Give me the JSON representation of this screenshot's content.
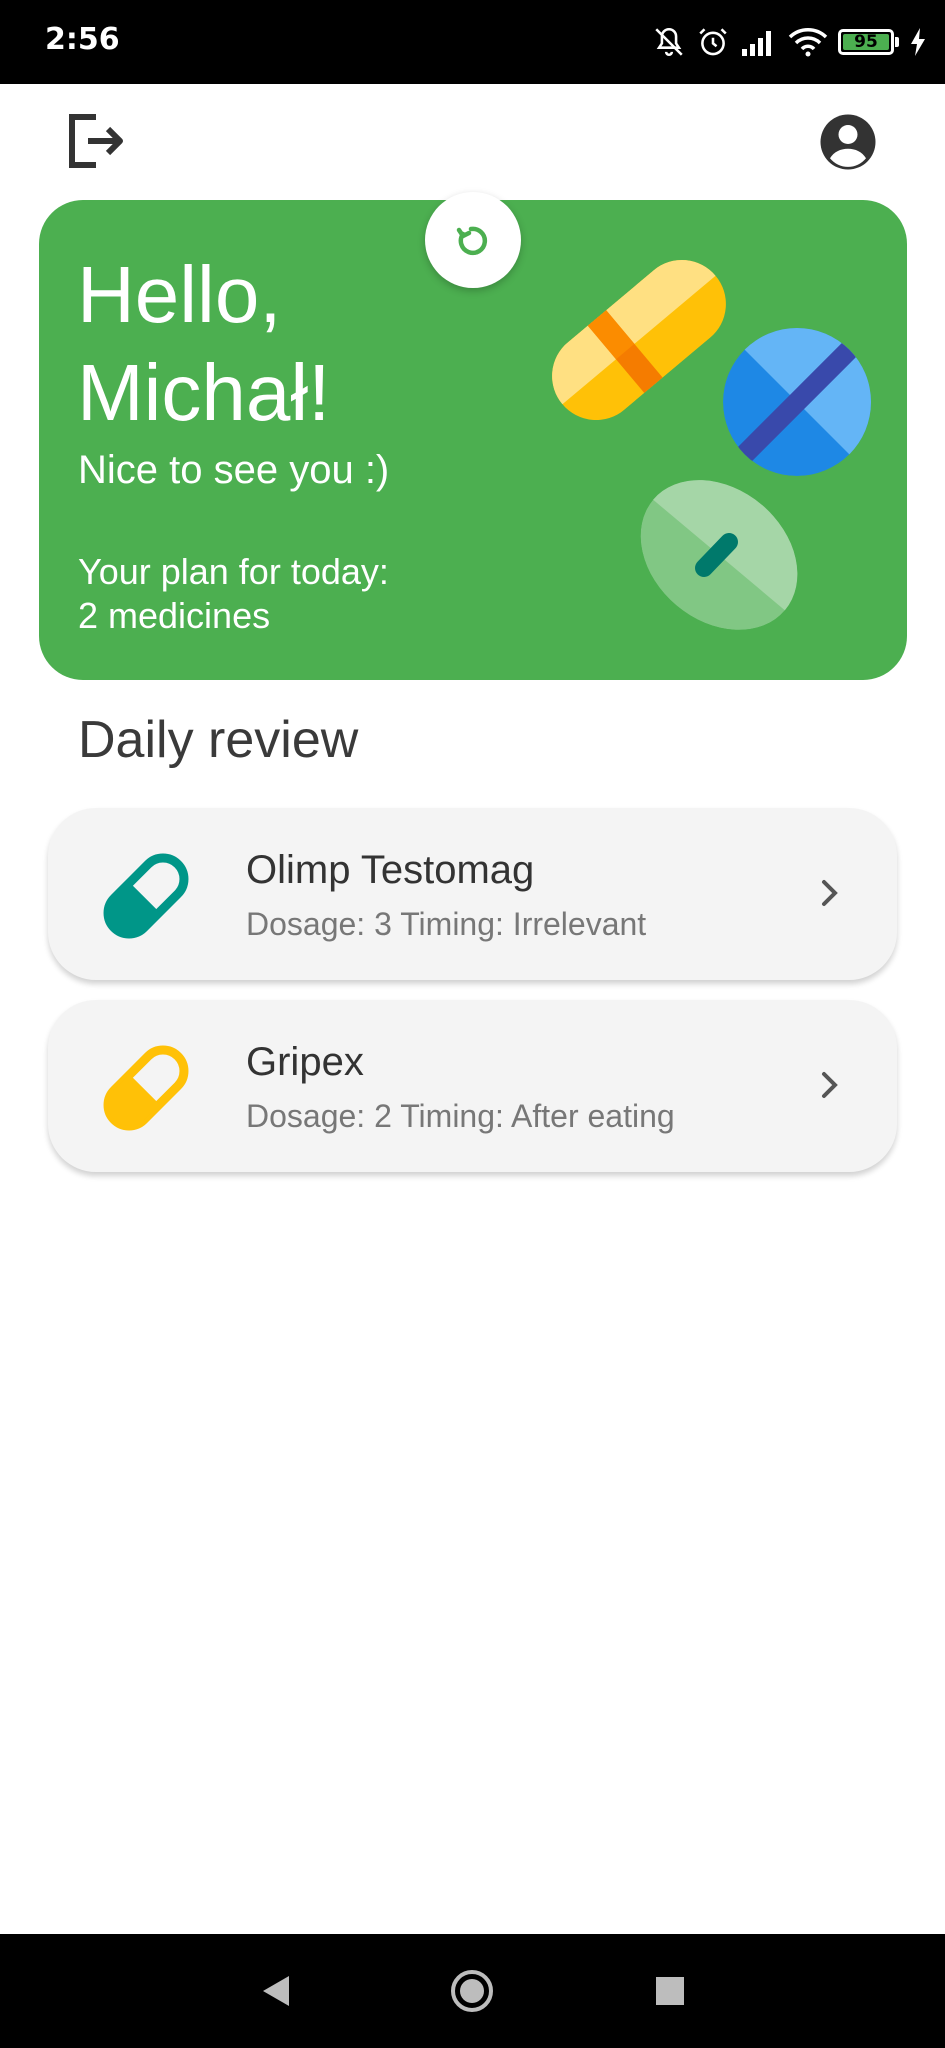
{
  "status_bar": {
    "time": "2:56",
    "battery_level": "95",
    "icons": [
      "bell-off-icon",
      "alarm-icon",
      "signal-icon",
      "wifi-icon",
      "battery-icon",
      "charging-icon"
    ]
  },
  "topbar": {
    "left_icon": "logout-icon",
    "right_icon": "account-circle-icon"
  },
  "hero": {
    "greeting": "Hello, Michał!",
    "subtitle": "Nice to see you :)",
    "plan_label": "Your plan for today:",
    "plan_value": "2 medicines",
    "refresh_icon": "refresh-icon",
    "background_color": "#4caf50"
  },
  "daily_review": {
    "title": "Daily review",
    "items": [
      {
        "name": "Olimp Testomag",
        "details": "Dosage: 3 Timing: Irrelevant",
        "icon": "pill-capsule-icon",
        "icon_color": "#009688"
      },
      {
        "name": "Gripex",
        "details": "Dosage: 2 Timing: After eating",
        "icon": "pill-capsule-icon",
        "icon_color": "#ffc107"
      }
    ]
  },
  "nav_bar": {
    "back_icon": "back-triangle-icon",
    "home_icon": "home-circle-icon",
    "recents_icon": "recents-square-icon"
  }
}
